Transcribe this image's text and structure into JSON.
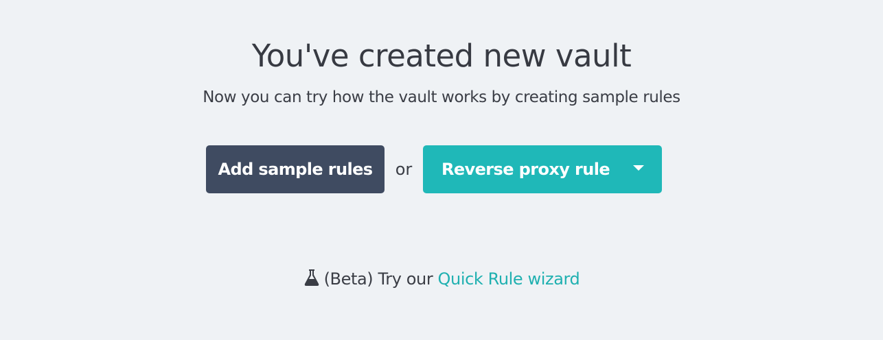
{
  "header": {
    "title": "You've created new vault",
    "subtitle": "Now you can try how the vault works by creating sample rules"
  },
  "actions": {
    "add_sample_label": "Add sample rules",
    "or_text": "or",
    "rule_select_value": "Reverse proxy rule"
  },
  "beta": {
    "prefix": "(Beta) Try our",
    "link_text": "Quick Rule wizard",
    "icon": "flask-icon"
  },
  "colors": {
    "background": "#eff2f5",
    "primary_dark": "#3f4b61",
    "accent_teal": "#1fb8b8",
    "link": "#1fb0b0",
    "text": "#3a3d45"
  }
}
